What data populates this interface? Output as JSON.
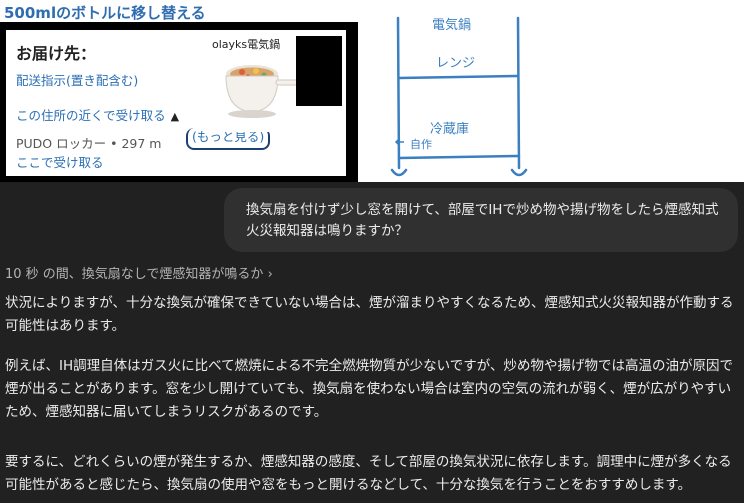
{
  "header": {
    "title": "500mlのボトルに移し替える"
  },
  "delivery": {
    "label": "お届け先：",
    "instruction_link": "配送指示(置き配含む)",
    "pickup_nearby": "この住所の近くで受け取る",
    "pudo_line": "PUDO ロッカー • 297 m",
    "more_link": "(もっと見る)",
    "pickup_here": "ここで受け取る"
  },
  "product": {
    "title": "olayks電気鍋"
  },
  "diagram": {
    "labels": [
      "電気鍋",
      "レンジ",
      "冷蔵庫",
      "自作"
    ]
  },
  "chat": {
    "user_message": "換気扇を付けず少し窓を開けて、部屋でIHで炒め物や揚げ物をしたら煙感知式火災報知器は鳴りますか？",
    "thought_summary": "10 秒 の間、換気扇なしで煙感知器が鳴るか",
    "paragraphs": [
      "状況によりますが、十分な換気が確保できていない場合は、煙が溜まりやすくなるため、煙感知式火災報知器が作動する可能性はあります。",
      "例えば、IH調理自体はガス火に比べて燃焼による不完全燃焼物質が少ないですが、炒め物や揚げ物では高温の油が原因で煙が出ることがあります。窓を少し開けていても、換気扇を使わない場合は室内の空気の流れが弱く、煙が広がりやすいため、煙感知器に届いてしまうリスクがあるのです。",
      "要するに、どれくらいの煙が発生するか、煙感知器の感度、そして部屋の換気状況に依存します。調理中に煙が多くなる可能性があると感じたら、換気扇の使用や窓をもっと開けるなどして、十分な換気を行うことをおすすめします。"
    ]
  },
  "icons": {
    "thought_chevron": "chevron-right-icon",
    "collapse_chevron": "chevron-up-icon"
  },
  "colors": {
    "link": "#2a6fb5",
    "diagram": "#3a7fc0",
    "chat_bg": "#212121",
    "bubble_bg": "#303030"
  }
}
